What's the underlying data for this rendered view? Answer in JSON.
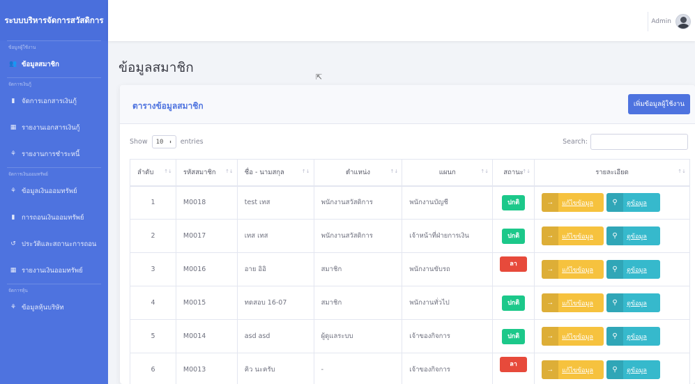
{
  "sidebar": {
    "brand": "ระบบบริหารจัดการสวัสดิการ",
    "sections": [
      {
        "heading": "ข้อมูลผู้ใช้งาน",
        "items": [
          {
            "label": "ข้อมูลสมาชิก",
            "icon": "users-icon",
            "active": true
          }
        ]
      },
      {
        "heading": "จัดการเงินกู้",
        "items": [
          {
            "label": "จัดการเอกสารเงินกู้",
            "icon": "file-icon"
          },
          {
            "label": "รายงานเอกสารเงินกู้",
            "icon": "table-icon"
          },
          {
            "label": "รายงานการชำระหนี้",
            "icon": "money-icon"
          }
        ]
      },
      {
        "heading": "จัดการเงินออมทรัพย์",
        "items": [
          {
            "label": "ข้อมูลเงินออมทรัพย์",
            "icon": "money-icon"
          },
          {
            "label": "การถอนเงินออมทรัพย์",
            "icon": "file-icon"
          },
          {
            "label": "ประวัติและสถานะการถอน",
            "icon": "history-icon"
          },
          {
            "label": "รายงานเงินออมทรัพย์",
            "icon": "table-icon"
          }
        ]
      },
      {
        "heading": "จัดการหุ้น",
        "items": [
          {
            "label": "ข้อมูลหุ้นบริษัท",
            "icon": "money-icon"
          }
        ]
      }
    ]
  },
  "topbar": {
    "user_name": "Admin"
  },
  "page_title": "ข้อมูลสมาชิก",
  "card": {
    "title": "ตารางข้อมูลสมาชิก",
    "add_button": "เพิ่มข้อมูลผู้ใช้งาน",
    "show_label": "Show",
    "entries_value": "10",
    "entries_label": "entries",
    "search_label": "Search:"
  },
  "table": {
    "headers": [
      "ลำดับ",
      "รหัสสมาชิก",
      "ชื่อ - นามสกุล",
      "ตำแหน่ง",
      "แผนก",
      "สถานะ",
      "รายละเอียด"
    ],
    "edit_label": "แก้ไขข้อมูล",
    "view_label": "ดูข้อมูล",
    "rows": [
      {
        "no": "1",
        "id": "M0018",
        "name": "test เทส",
        "position": "พนักงานสวัสดิการ",
        "dept": "พนักงานบัญชี",
        "status": "ปกติ",
        "status_type": "ok"
      },
      {
        "no": "2",
        "id": "M0017",
        "name": "เทส เทส",
        "position": "พนักงานสวัสดิการ",
        "dept": "เจ้าหน้าที่ฝ่ายการเงิน",
        "status": "ปกติ",
        "status_type": "ok"
      },
      {
        "no": "3",
        "id": "M0016",
        "name": "อาย อิอิ",
        "position": "สมาชิก",
        "dept": "พนักงานขับรถ",
        "status": "ลาออก",
        "status_type": "out"
      },
      {
        "no": "4",
        "id": "M0015",
        "name": "ทดสอบ 16-07",
        "position": "สมาชิก",
        "dept": "พนักงานทั่วไป",
        "status": "ปกติ",
        "status_type": "ok"
      },
      {
        "no": "5",
        "id": "M0014",
        "name": "asd asd",
        "position": "ผู้ดูแลระบบ",
        "dept": "เจ้าของกิจการ",
        "status": "ปกติ",
        "status_type": "ok"
      },
      {
        "no": "6",
        "id": "M0013",
        "name": "คิว นะครับ",
        "position": "-",
        "dept": "เจ้าของกิจการ",
        "status": "ลาออก",
        "status_type": "out"
      }
    ]
  },
  "colors": {
    "primary": "#4e73df",
    "success": "#1cc88a",
    "danger": "#e74a3b",
    "warning": "#f6c23e",
    "info": "#36b9cc"
  }
}
